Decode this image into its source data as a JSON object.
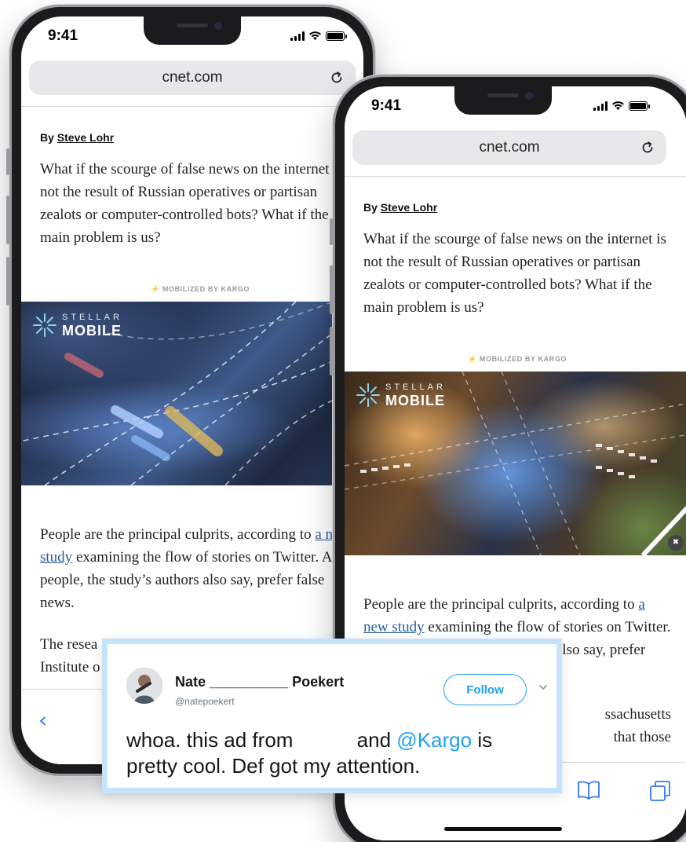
{
  "status": {
    "time": "9:41"
  },
  "browser": {
    "url": "cnet.com"
  },
  "article": {
    "byline_prefix": "By",
    "author": "Steve Lohr",
    "para1": "What if the scourge of false news on the internet is not the result of Russian operatives or partisan zealots or computer-controlled bots? What if the main problem is us?",
    "mobilized_by": "MOBILIZED BY KARGO",
    "para2_before": "People are the principal culprits, according to",
    "para2_link": "a new study",
    "para2_after": "examining the flow of stories on Twitter. And people, the study’s authors also say, prefer false news.",
    "para3_visible_left": "The resea",
    "para3_line2_left": "Institute o",
    "para3_right_a": "ssachusetts",
    "para3_right_b": "that those"
  },
  "ad": {
    "brand_line1": "STELLAR",
    "brand_line2": "MOBILE"
  },
  "tweet": {
    "name_first": "Nate",
    "name_blank": "__________",
    "name_last": "Poekert",
    "handle": "@natepoekert",
    "follow_label": "Follow",
    "text_part1": "whoa. this ad from",
    "text_part2": "and",
    "mention": "@Kargo",
    "text_part3": "is",
    "text_line2": "pretty cool. Def got my attention."
  },
  "colors": {
    "link": "#2a5d9a",
    "twitter_blue": "#1da1f2",
    "tweet_border": "#c7e2fb",
    "ios_blue": "#3478f6"
  }
}
